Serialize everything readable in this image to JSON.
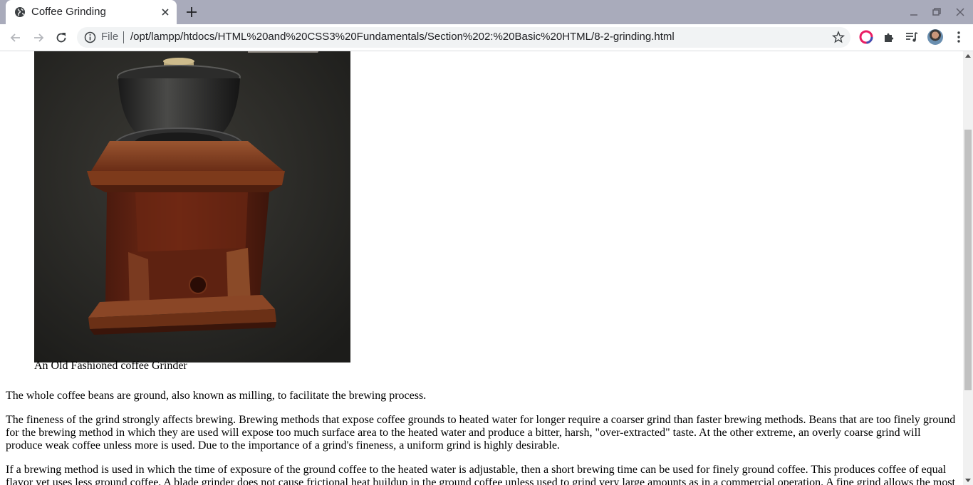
{
  "browser": {
    "tab": {
      "title": "Coffee Grinding"
    },
    "address_bar": {
      "scheme_label": "File",
      "url": "/opt/lampp/htdocs/HTML%20and%20CSS3%20Fundamentals/Section%202:%20Basic%20HTML/8-2-grinding.html"
    }
  },
  "page": {
    "figure": {
      "image_alt": "An Old Fashioned coffee Grinder",
      "caption": "An Old Fashioned coffee Grinder"
    },
    "paragraphs": [
      "The whole coffee beans are ground, also known as milling, to facilitate the brewing process.",
      "The fineness of the grind strongly affects brewing. Brewing methods that expose coffee grounds to heated water for longer require a coarser grind than faster brewing methods. Beans that are too finely ground for the brewing method in which they are used will expose too much surface area to the heated water and produce a bitter, harsh, \"over-extracted\" taste. At the other extreme, an overly coarse grind will produce weak coffee unless more is used. Due to the importance of a grind's fineness, a uniform grind is highly desirable.",
      "If a brewing method is used in which the time of exposure of the ground coffee to the heated water is adjustable, then a short brewing time can be used for finely ground coffee. This produces coffee of equal flavor yet uses less ground coffee. A blade grinder does not cause frictional heat buildup in the ground coffee unless used to grind very large amounts as in a commercial operation. A fine grind allows the most"
    ]
  },
  "icons": {
    "tab_favicon": "globe-icon",
    "tab_close": "close-icon",
    "new_tab": "plus-icon",
    "back": "arrow-left-icon",
    "forward": "arrow-right-icon",
    "reload": "reload-icon",
    "site_info": "info-icon",
    "bookmark": "star-icon",
    "extensions": "puzzle-icon",
    "media": "media-queue-icon"
  }
}
